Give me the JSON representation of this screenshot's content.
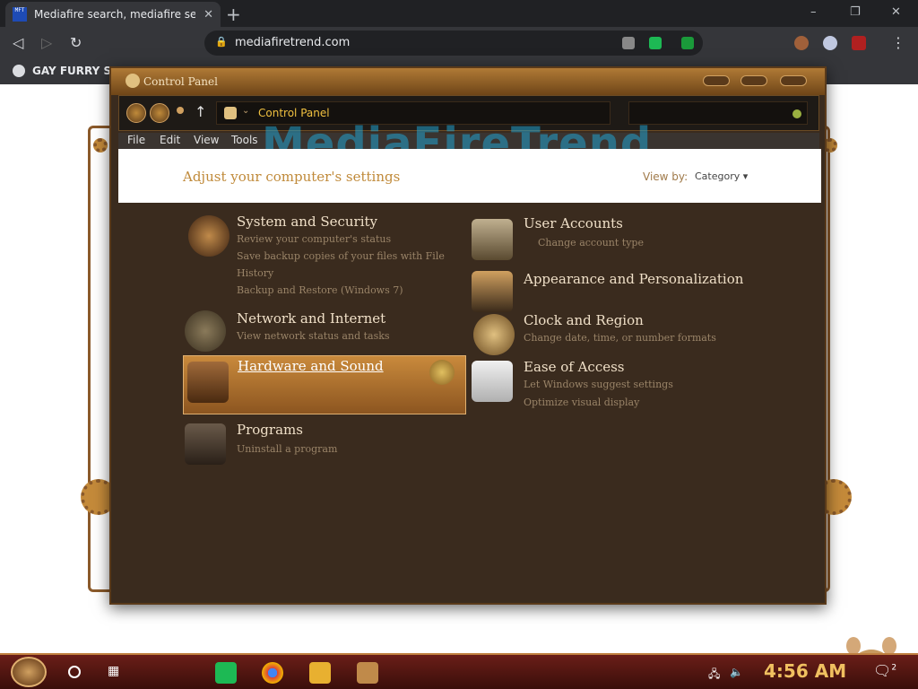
{
  "browser": {
    "tab_title": "Mediafire search, mediafire sea",
    "favicon_text": "MFT",
    "new_tab": "+",
    "url": "mediafiretrend.com",
    "bookmark": "GAY FURRY SE"
  },
  "window": {
    "title": "Control Panel",
    "address_path": "Control Panel",
    "watermark": "MediaFireTrend"
  },
  "menu": {
    "file": "File",
    "edit": "Edit",
    "view": "View",
    "tools": "Tools"
  },
  "header": {
    "title": "Adjust your computer's settings",
    "view_by_label": "View by:",
    "view_by_value": "Category ▾"
  },
  "categories": {
    "system": {
      "title": "System and Security",
      "links": [
        "Review your computer's status",
        "Save backup copies of your files with File",
        "History",
        "Backup and Restore (Windows 7)"
      ]
    },
    "network": {
      "title": "Network and Internet",
      "links": [
        "View network status and tasks"
      ]
    },
    "hardware": {
      "title": "Hardware and Sound"
    },
    "programs": {
      "title": "Programs",
      "links": [
        "Uninstall a program"
      ]
    },
    "users": {
      "title": "User Accounts",
      "links": [
        "Change account type"
      ]
    },
    "appearance": {
      "title": "Appearance and Personalization"
    },
    "clock": {
      "title": "Clock and Region",
      "links": [
        "Change date, time, or number formats"
      ]
    },
    "ease": {
      "title": "Ease of Access",
      "links": [
        "Let Windows suggest settings",
        "Optimize visual display"
      ]
    }
  },
  "taskbar": {
    "clock": "4:56 AM",
    "notification_count": "2"
  },
  "icons": {
    "back": "◁",
    "forward": "▷",
    "reload": "↻",
    "close": "✕",
    "minimize": "–",
    "maximize": "❐",
    "up_arrow": "↑",
    "refresh": "↻",
    "chevron": "⌄",
    "menu_dots": "⋮",
    "lock": "🔒",
    "speaker": "🔈",
    "network": "🖧",
    "notifications": "🗨"
  },
  "colors": {
    "chrome_dark": "#202124",
    "window_brown": "#3a2b1e",
    "accent_gold": "#c08a3a",
    "taskbar_red": "#6a1e18"
  }
}
